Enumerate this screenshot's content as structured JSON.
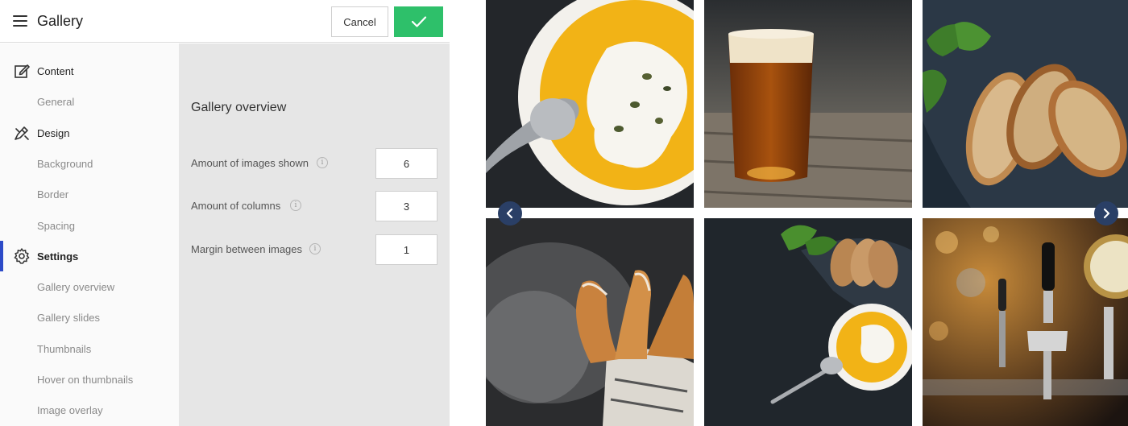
{
  "header": {
    "title": "Gallery",
    "cancel_label": "Cancel"
  },
  "sidebar": {
    "items": [
      {
        "label": "Content",
        "type": "section",
        "icon": "edit-icon"
      },
      {
        "label": "General",
        "type": "sub"
      },
      {
        "label": "Design",
        "type": "section",
        "icon": "brush-icon"
      },
      {
        "label": "Background",
        "type": "sub"
      },
      {
        "label": "Border",
        "type": "sub"
      },
      {
        "label": "Spacing",
        "type": "sub"
      },
      {
        "label": "Settings",
        "type": "section",
        "icon": "gear-icon",
        "active": true
      },
      {
        "label": "Gallery overview",
        "type": "sub"
      },
      {
        "label": "Gallery slides",
        "type": "sub"
      },
      {
        "label": "Thumbnails",
        "type": "sub"
      },
      {
        "label": "Hover on thumbnails",
        "type": "sub"
      },
      {
        "label": "Image overlay",
        "type": "sub"
      }
    ]
  },
  "panel": {
    "title": "Gallery overview",
    "fields": [
      {
        "label": "Amount of images shown",
        "value": "6"
      },
      {
        "label": "Amount of columns",
        "value": "3"
      },
      {
        "label": "Margin between images",
        "value": "1"
      }
    ]
  },
  "gallery": {
    "images": [
      {
        "name": "pumpkin-soup-image"
      },
      {
        "name": "beer-glass-image"
      },
      {
        "name": "toasted-bread-image"
      },
      {
        "name": "churros-image"
      },
      {
        "name": "soup-and-bread-image"
      },
      {
        "name": "beer-taps-image"
      }
    ],
    "prev_icon": "chevron-left-icon",
    "next_icon": "chevron-right-icon"
  },
  "colors": {
    "accent": "#2ec06a",
    "active_indicator": "#2d4bc8",
    "arrow_bg": "#2a3f66",
    "panel_bg": "#e6e6e6",
    "sidebar_bg": "#fafafa"
  }
}
